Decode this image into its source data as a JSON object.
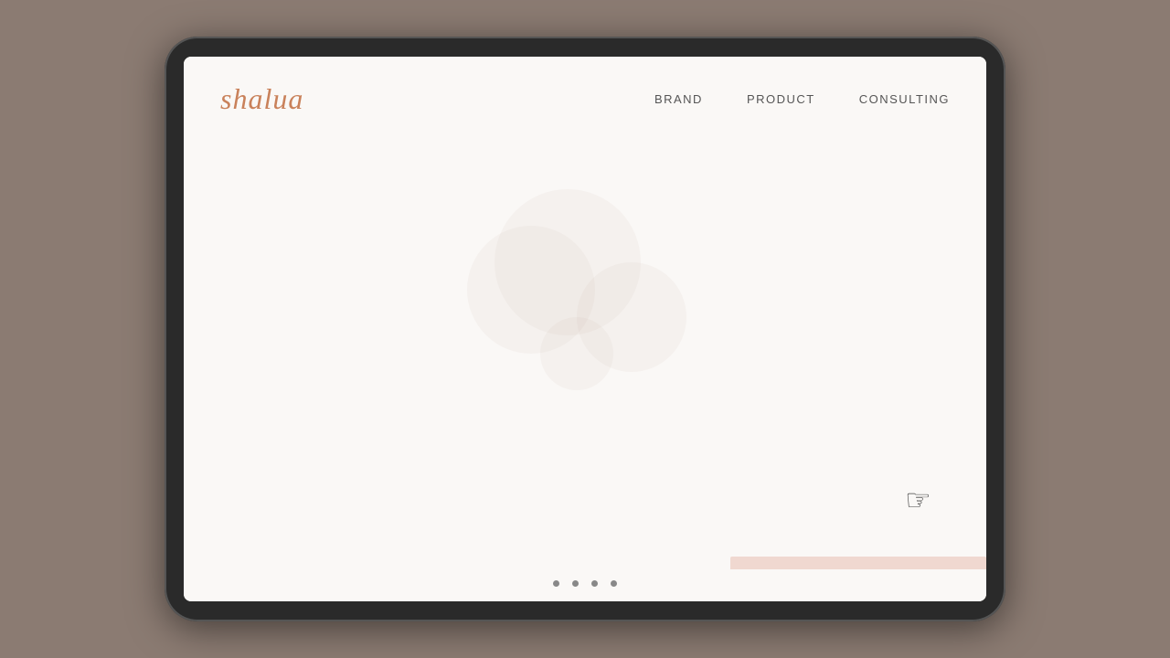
{
  "tablet": {
    "logo": "shalua",
    "nav": {
      "items": [
        {
          "label": "BRAND",
          "id": "brand"
        },
        {
          "label": "PRODUCT",
          "id": "product"
        },
        {
          "label": "CONSULTING",
          "id": "consulting"
        }
      ]
    },
    "footer_dots": [
      {
        "active": false
      },
      {
        "active": false
      },
      {
        "active": false
      },
      {
        "active": false
      }
    ]
  },
  "colors": {
    "logo_color": "#c9815a",
    "nav_color": "#555555",
    "background": "#faf8f6",
    "tablet_outer": "#2a2a2a",
    "body_bg": "#8b7b72"
  }
}
